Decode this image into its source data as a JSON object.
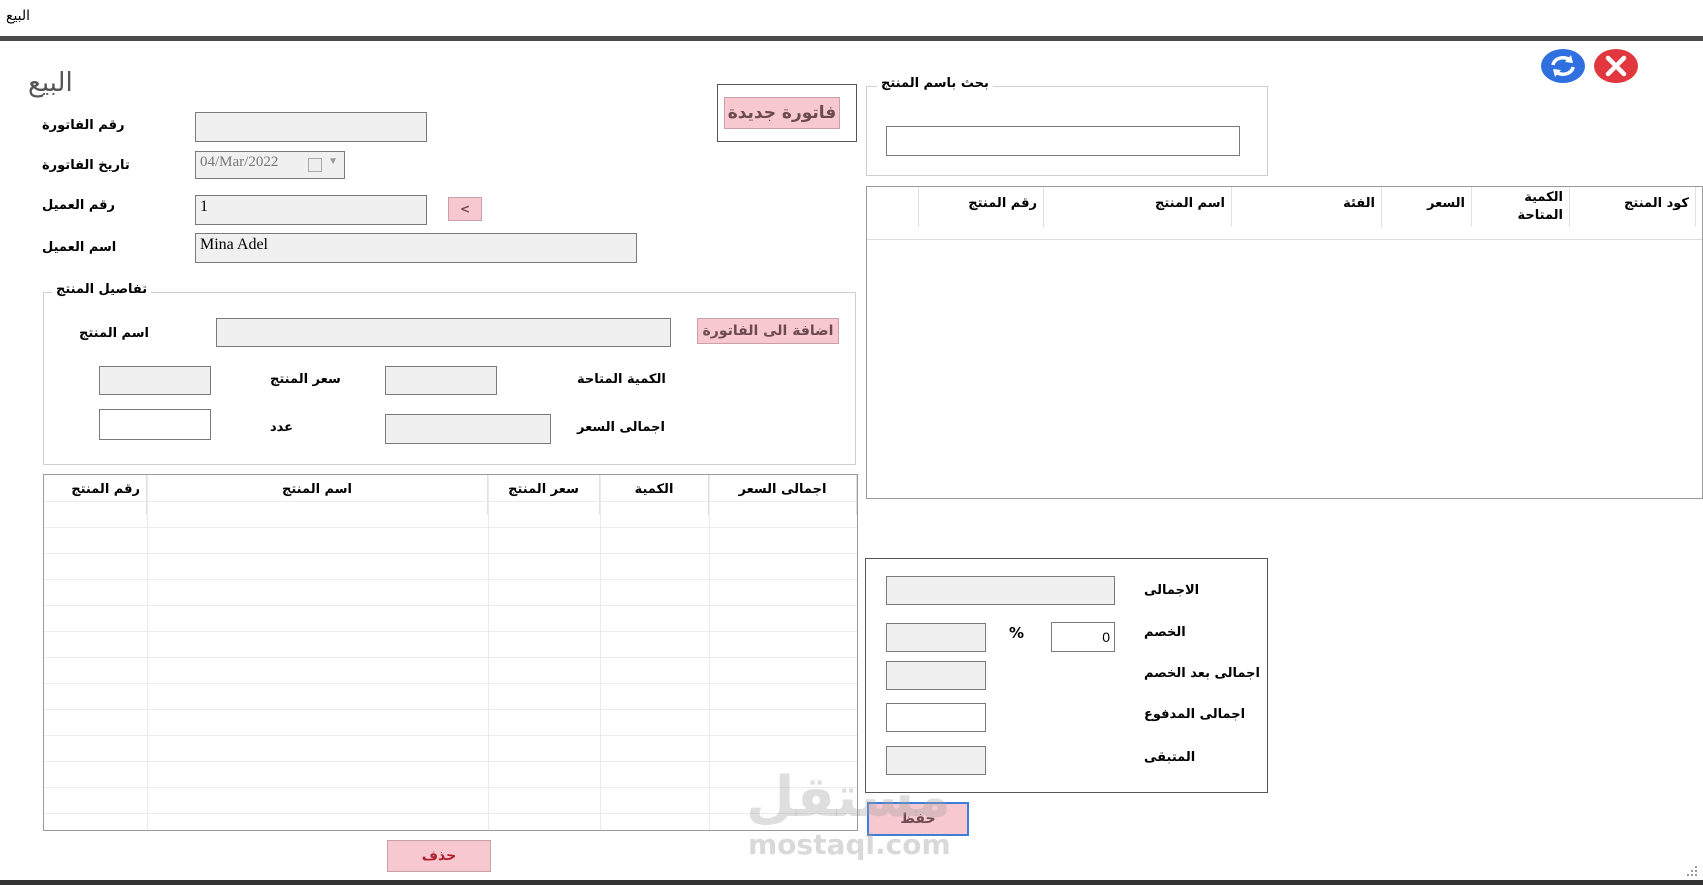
{
  "window": {
    "title": "البيع"
  },
  "page": {
    "heading": "البيع"
  },
  "invoice": {
    "number_label": "رقم الفاتورة",
    "number_value": "",
    "date_label": "تاريخ الفاتورة",
    "date_value": "04/Mar/2022",
    "customer_no_label": "رقم العميل",
    "customer_no_value": "1",
    "customer_pick": "<",
    "customer_name_label": "اسم العميل",
    "customer_name_value": "Mina Adel",
    "new_invoice_button": "فاتورة جديدة"
  },
  "search": {
    "group_title": "بحث باسم المنتج",
    "value": ""
  },
  "products_grid": {
    "columns": [
      "كود المنتج",
      "الكمية المتاحة",
      "السعر",
      "الفئة",
      "اسم المنتج",
      "رقم المنتج"
    ]
  },
  "product_details": {
    "group_title": "تفاصيل المنتج",
    "name_label": "اسم المنتج",
    "add_button": "اضافة الى الفاتورة",
    "available_qty_label": "الكمية المتاحة",
    "price_label": "سعر المنتج",
    "total_price_label": "اجمالى السعر",
    "count_label": "عدد"
  },
  "invoice_grid": {
    "columns": [
      "رقم المنتج",
      "اسم المنتج",
      "سعر المنتج",
      "الكمية",
      "اجمالى السعر"
    ]
  },
  "totals": {
    "total_label": "الاجمالى",
    "discount_label": "الخصم",
    "discount_value": "0",
    "percent_sign": "%",
    "after_discount_label": "اجمالى بعد الخصم",
    "paid_label": "اجمالى المدفوع",
    "remaining_label": "المتبقى"
  },
  "actions": {
    "delete_button": "حذف",
    "save_button": "حفظ"
  },
  "watermark": {
    "arabic": "مستقل",
    "latin": "mostaql.com"
  },
  "colors": {
    "pink": "#f8c8d0",
    "blue": "#2f6fe0",
    "red": "#e0383e"
  }
}
